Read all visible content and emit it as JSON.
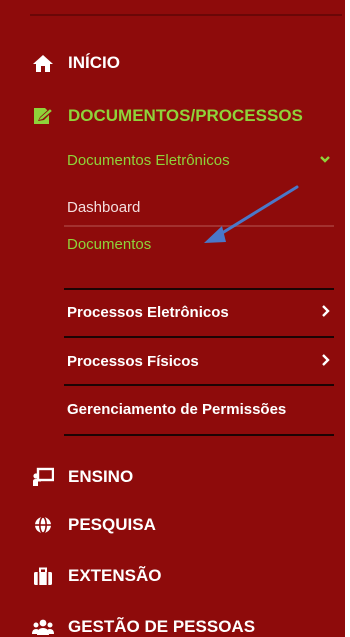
{
  "menu": {
    "inicio": "INÍCIO",
    "documentos_processos": "DOCUMENTOS/PROCESSOS",
    "documentos_eletronicos": "Documentos Eletrônicos",
    "dashboard": "Dashboard",
    "documentos": "Documentos",
    "processos_eletronicos": "Processos Eletrônicos",
    "processos_fisicos": "Processos Físicos",
    "gerenciamento_permissoes": "Gerenciamento de Permissões",
    "ensino": "ENSINO",
    "pesquisa": "PESQUISA",
    "extensao": "EXTENSÃO",
    "gestao_pessoas": "GESTÃO DE PESSOAS"
  },
  "icons": {
    "inicio": "home-icon",
    "documentos_processos": "edit-document-icon",
    "ensino": "presentation-icon",
    "pesquisa": "globe-icon",
    "extensao": "briefcase-icon",
    "gestao_pessoas": "users-icon",
    "expanded": "chevron-down-icon",
    "collapsed": "chevron-right-icon"
  },
  "colors": {
    "sidebar_bg": "#8e0b0b",
    "active_green": "#8fd33a",
    "text": "#ffffff",
    "annotation_arrow": "#4a78c9"
  }
}
